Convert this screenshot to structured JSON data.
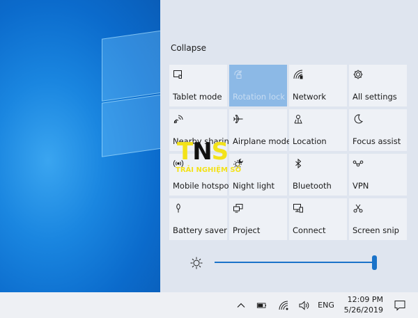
{
  "action_center": {
    "collapse_label": "Collapse",
    "tiles": [
      {
        "label": "Tablet mode",
        "icon": "tablet-mode-icon",
        "active": false
      },
      {
        "label": "Rotation lock",
        "icon": "rotation-lock-icon",
        "active": true
      },
      {
        "label": "Network",
        "icon": "network-icon",
        "active": false
      },
      {
        "label": "All settings",
        "icon": "gear-icon",
        "active": false
      },
      {
        "label": "Nearby sharing",
        "icon": "nearby-sharing-icon",
        "active": false
      },
      {
        "label": "Airplane mode",
        "icon": "airplane-icon",
        "active": false
      },
      {
        "label": "Location",
        "icon": "location-icon",
        "active": false
      },
      {
        "label": "Focus assist",
        "icon": "moon-icon",
        "active": false
      },
      {
        "label": "Mobile hotspot",
        "icon": "hotspot-icon",
        "active": false
      },
      {
        "label": "Night light",
        "icon": "night-light-icon",
        "active": false
      },
      {
        "label": "Bluetooth",
        "icon": "bluetooth-icon",
        "active": false
      },
      {
        "label": "VPN",
        "icon": "vpn-icon",
        "active": false
      },
      {
        "label": "Battery saver",
        "icon": "battery-saver-icon",
        "active": false
      },
      {
        "label": "Project",
        "icon": "project-icon",
        "active": false
      },
      {
        "label": "Connect",
        "icon": "connect-icon",
        "active": false
      },
      {
        "label": "Screen snip",
        "icon": "screen-snip-icon",
        "active": false
      }
    ],
    "brightness_percent": 100,
    "accent_color": "#1a73c9",
    "active_tile_color": "#8cb9e6"
  },
  "taskbar": {
    "language": "ENG",
    "time": "12:09 PM",
    "date": "5/26/2019"
  },
  "watermark": {
    "brand": "TNS",
    "tagline": "TRẢI NGHIỆM SỐ"
  }
}
